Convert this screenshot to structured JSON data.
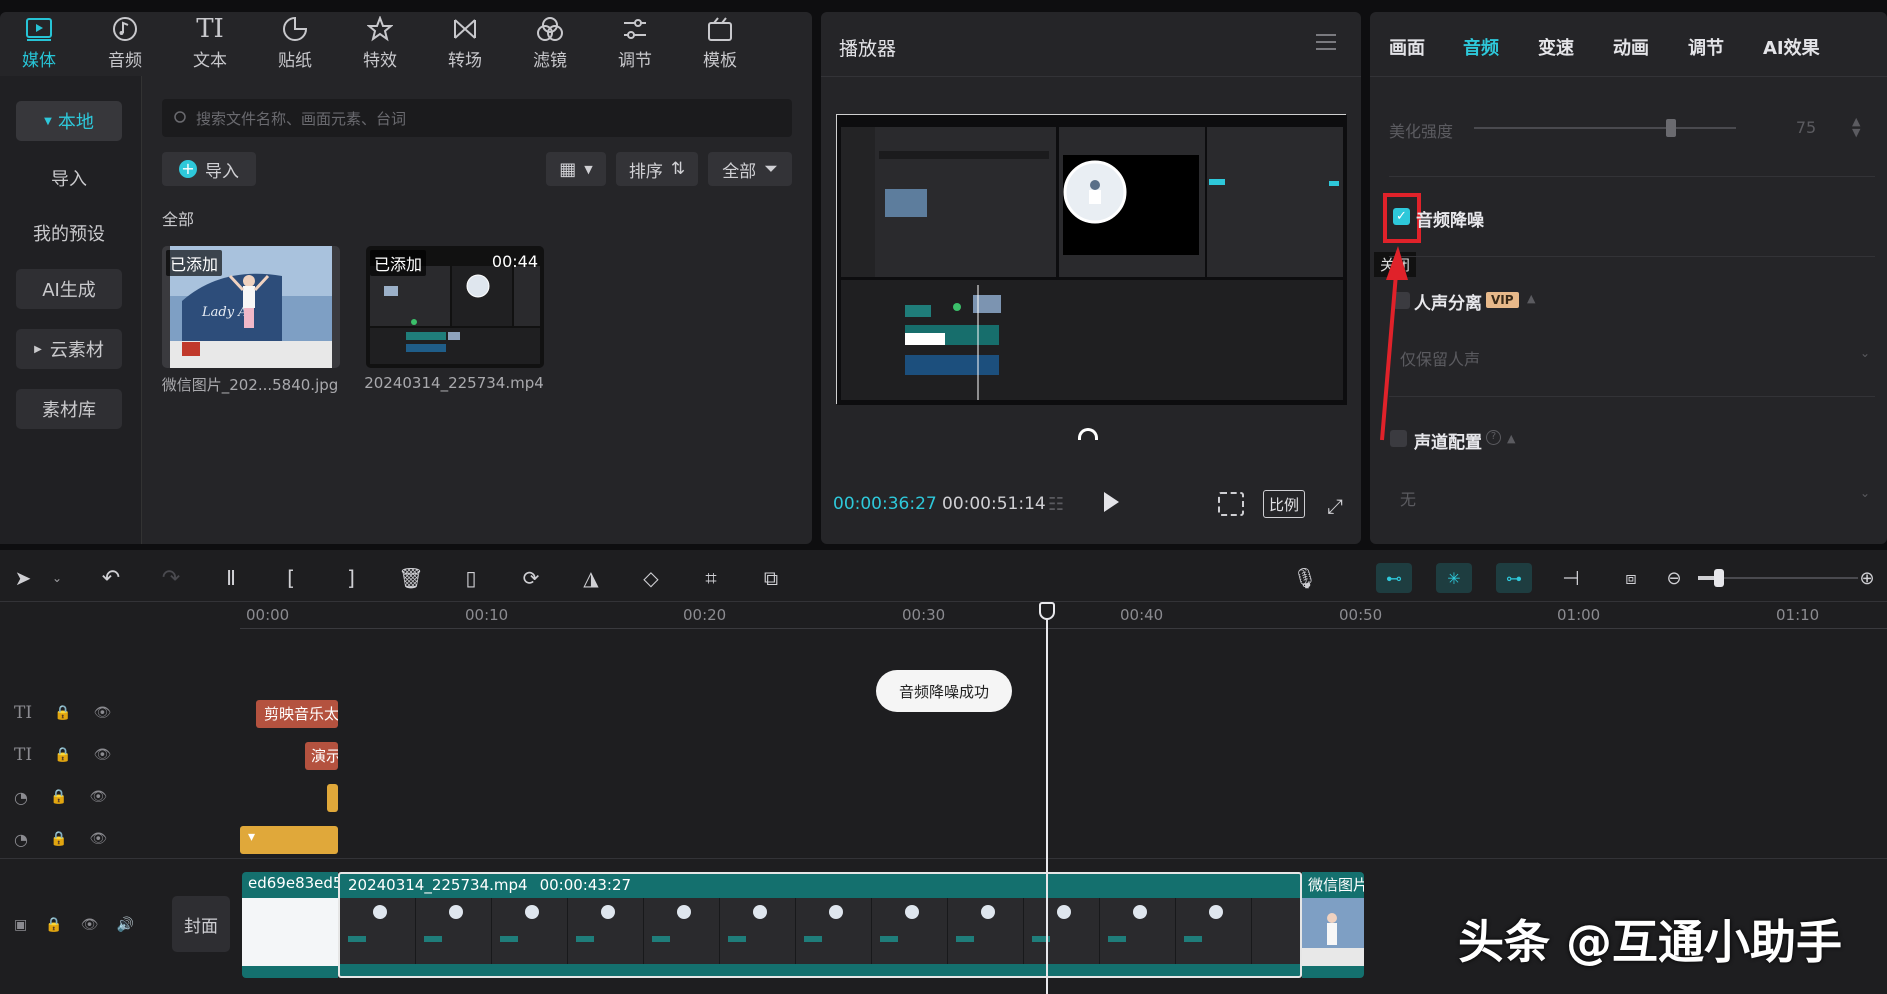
{
  "toolbar": {
    "items": [
      {
        "label": "媒体",
        "icon": "media-icon",
        "active": true
      },
      {
        "label": "音频",
        "icon": "audio-icon"
      },
      {
        "label": "文本",
        "icon": "text-icon"
      },
      {
        "label": "贴纸",
        "icon": "sticker-icon"
      },
      {
        "label": "特效",
        "icon": "effects-icon"
      },
      {
        "label": "转场",
        "icon": "transition-icon"
      },
      {
        "label": "滤镜",
        "icon": "filter-icon"
      },
      {
        "label": "调节",
        "icon": "adjust-icon"
      },
      {
        "label": "模板",
        "icon": "template-icon"
      }
    ]
  },
  "sidebar": {
    "items": [
      {
        "label": "本地",
        "selected": true
      },
      {
        "label": "导入"
      },
      {
        "label": "我的预设"
      },
      {
        "label": "AI生成"
      },
      {
        "label": "云素材"
      },
      {
        "label": "素材库"
      }
    ]
  },
  "media": {
    "search_placeholder": "搜索文件名称、画面元素、台词",
    "import_label": "导入",
    "sort_label": "排序",
    "filter_label": "全部",
    "section_label": "全部",
    "files": [
      {
        "tag": "已添加",
        "name": "微信图片_202...5840.jpg",
        "duration": ""
      },
      {
        "tag": "已添加",
        "name": "20240314_225734.mp4",
        "duration": "00:44"
      }
    ]
  },
  "player": {
    "title": "播放器",
    "current_time": "00:00:36:27",
    "total_time": "00:00:51:14",
    "ratio_label": "比例"
  },
  "inspector": {
    "tabs": [
      {
        "label": "画面"
      },
      {
        "label": "音频",
        "active": true
      },
      {
        "label": "变速"
      },
      {
        "label": "动画"
      },
      {
        "label": "调节"
      },
      {
        "label": "AI效果"
      }
    ],
    "beautify_label": "美化强度",
    "beautify_value": "75",
    "beautify_level": 0.75,
    "denoise_label": "音频降噪",
    "denoise_checked": true,
    "tooltip": "关闭",
    "vocal_sep_label": "人声分离",
    "vip_badge": "VIP",
    "vocal_option": "仅保留人声",
    "channel_label": "声道配置",
    "channel_option": "无"
  },
  "timeline": {
    "ticks": [
      "00:00",
      "00:10",
      "00:20",
      "00:30",
      "00:40",
      "00:50",
      "01:00",
      "01:10"
    ],
    "toast": "音频降噪成功",
    "cover_label": "封面",
    "clips": {
      "text1": "剪映音乐太",
      "text2": "演示",
      "main_left": "ed69e83ed5",
      "main_name": "20240314_225734.mp4",
      "main_duration": "00:00:43:27",
      "main_right": "微信图片"
    }
  },
  "watermark": "头条 @互通小助手",
  "colors": {
    "accent": "#2ec8da",
    "clip_teal": "#14706e",
    "text_clip": "#b4523f",
    "sticker_clip": "#e0a83a",
    "annotation_red": "#e0222a"
  }
}
